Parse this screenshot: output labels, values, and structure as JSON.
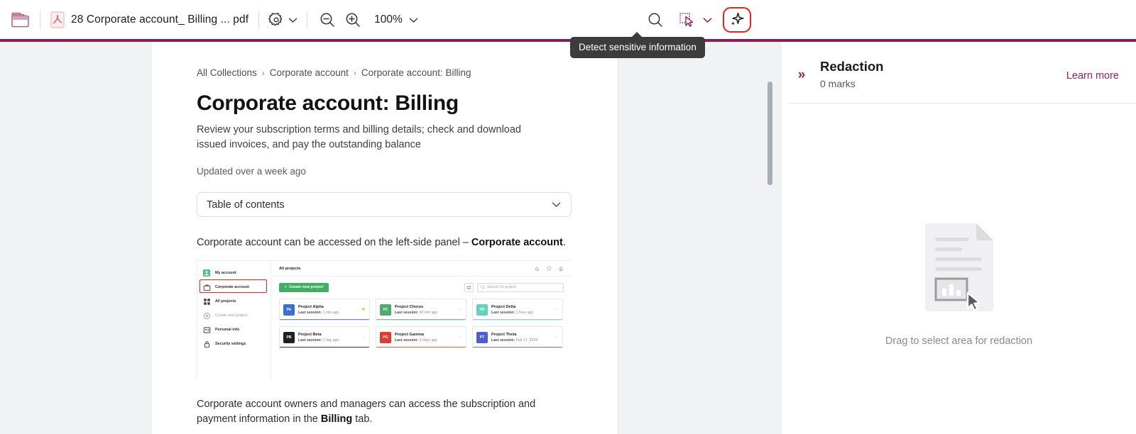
{
  "toolbar": {
    "folder_icon": "folder-icon",
    "file_type_icon": "pdf-file-icon",
    "file_name": "28 Corporate account_ Billing ... pdf",
    "settings_icon": "gear-icon",
    "settings_caret": "chevron-down-icon",
    "zoom_out_icon": "zoom-out-icon",
    "zoom_in_icon": "zoom-in-icon",
    "zoom_level": "100%",
    "zoom_caret": "chevron-down-icon",
    "search_icon": "search-icon",
    "select_area_icon": "select-area-cursor-icon",
    "select_caret": "chevron-down-icon",
    "ai_detect_icon": "sparkle-icon",
    "tooltip": "Detect sensitive information",
    "highlight_color": "#f01e1e",
    "accent_color": "#8c1d53"
  },
  "document": {
    "breadcrumb": [
      {
        "label": "All Collections"
      },
      {
        "label": "Corporate account"
      },
      {
        "label": "Corporate account: Billing"
      }
    ],
    "breadcrumb_separator": "›",
    "title": "Corporate account: Billing",
    "subtitle": "Review your subscription terms and billing details; check and download issued invoices, and pay the outstanding balance",
    "updated": "Updated over a week ago",
    "toc_label": "Table of contents",
    "toc_caret": "chevron-down-icon",
    "paragraph_1_prefix": "Corporate account can be accessed on the left-side panel – ",
    "paragraph_1_bold": "Corporate account",
    "paragraph_1_suffix": ".",
    "paragraph_2_prefix": "Corporate account owners and managers can access the subscription and payment information in the ",
    "paragraph_2_bold": "Billing",
    "paragraph_2_suffix": " tab."
  },
  "embedded_screenshot": {
    "sidebar": [
      {
        "label": "My account",
        "icon": "person-badge-icon",
        "active": true
      },
      {
        "label": "Corporate account",
        "icon": "briefcase-icon",
        "highlighted": true
      },
      {
        "label": "All projects",
        "icon": "grid-icon"
      },
      {
        "label": "Create new project",
        "icon": "plus-circle-icon",
        "dim": true
      },
      {
        "label": "Personal info",
        "icon": "id-card-icon"
      },
      {
        "label": "Security settings",
        "icon": "lock-icon"
      }
    ],
    "header_title": "All projects",
    "header_icons": [
      "moon-icon",
      "help-circle-icon",
      "avatar"
    ],
    "create_button": "Create new project",
    "create_button_color": "#3faf63",
    "list_toggle_icon": "list-view-icon",
    "search_placeholder": "Search for project",
    "search_icon": "search-icon",
    "projects": [
      {
        "initials": "PA",
        "name": "Project Alpha",
        "meta_label": "Last session:",
        "meta_value": "1 min ago",
        "tile_color": "#3a6fd8",
        "bar_color": "#5b8dea",
        "starred": true
      },
      {
        "initials": "PC",
        "name": "Project Chorus",
        "meta_label": "Last session:",
        "meta_value": "40 min ago",
        "tile_color": "#4eab6b",
        "bar_color": "#73c48c",
        "starred": false
      },
      {
        "initials": "PD",
        "name": "Project Delta",
        "meta_label": "Last session:",
        "meta_value": "1 hour ago",
        "tile_color": "#5fd3c0",
        "bar_color": "#7fdfd0",
        "starred": false
      },
      {
        "initials": "PB",
        "name": "Project Beta",
        "meta_label": "Last session:",
        "meta_value": "1 day ago",
        "tile_color": "#1d2127",
        "bar_color": "#3b4049",
        "starred": false
      },
      {
        "initials": "PG",
        "name": "Project Gamma",
        "meta_label": "Last session:",
        "meta_value": "3 days ago",
        "tile_color": "#e03b32",
        "bar_color": "#ea6a62",
        "starred": false
      },
      {
        "initials": "PT",
        "name": "Project Theta",
        "meta_label": "Last session:",
        "meta_value": "Feb 17, 2024",
        "tile_color": "#4a5fd6",
        "bar_color": "#7183e4",
        "starred": false
      }
    ],
    "highlight_color": "#ef2020",
    "star_color": "#f5b81e"
  },
  "redaction_panel": {
    "collapse_icon": "double-chevron-right-icon",
    "title": "Redaction",
    "marks_count": "0 marks",
    "learn_more": "Learn more",
    "learn_more_color": "#a51d54",
    "empty_illustration": "document-selection-icon",
    "empty_caption": "Drag to select area for redaction"
  }
}
